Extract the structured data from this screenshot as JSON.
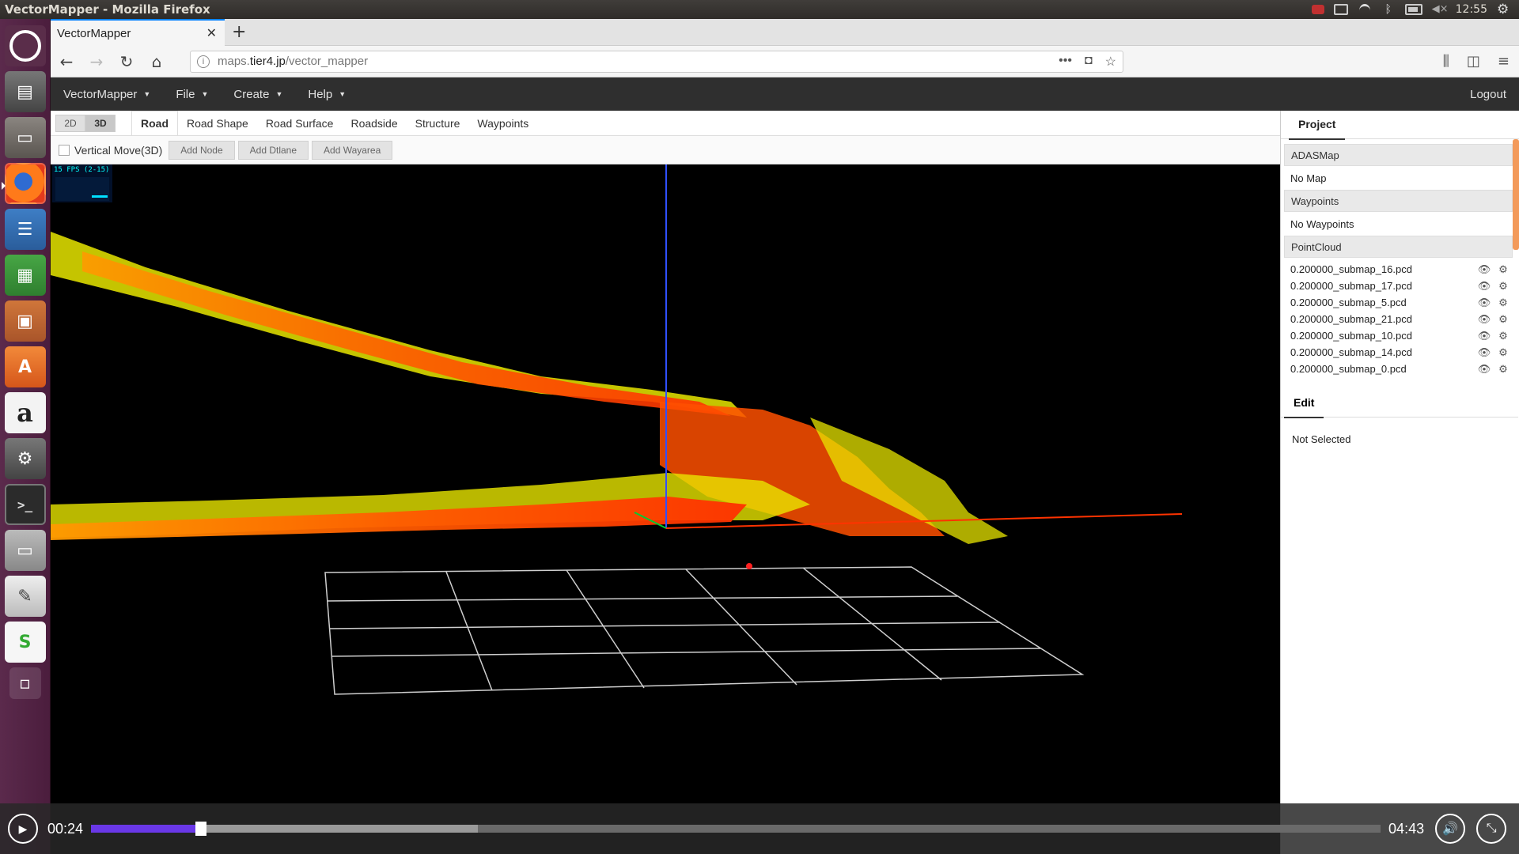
{
  "system": {
    "window_title": "VectorMapper - Mozilla Firefox",
    "clock": "12:55"
  },
  "launcher": {
    "icons": [
      "ubuntu-dash-icon",
      "system-info-icon",
      "files-icon",
      "firefox-icon",
      "libreoffice-writer-icon",
      "libreoffice-calc-icon",
      "libreoffice-impress-icon",
      "software-center-icon",
      "amazon-icon",
      "system-settings-icon",
      "terminal-icon",
      "window-icon",
      "text-editor-icon",
      "slack-icon",
      "trash-icon"
    ]
  },
  "browser": {
    "tab_title": "VectorMapper",
    "url_plain": "maps.",
    "url_host": "tier4.jp",
    "url_path": "/vector_mapper"
  },
  "appbar": {
    "menus": [
      {
        "label": "VectorMapper"
      },
      {
        "label": "File"
      },
      {
        "label": "Create"
      },
      {
        "label": "Help"
      }
    ],
    "logout": "Logout"
  },
  "toolbar": {
    "dim_2d": "2D",
    "dim_3d": "3D",
    "tabs": [
      "Road",
      "Road Shape",
      "Road Surface",
      "Roadside",
      "Structure",
      "Waypoints"
    ],
    "vertical_move": "Vertical Move(3D)",
    "add_node": "Add Node",
    "add_dtlane": "Add Dtlane",
    "add_wayarea": "Add Wayarea"
  },
  "viewport": {
    "fps_label": "15 FPS (2-15)"
  },
  "project": {
    "tab_label": "Project",
    "adasmap_header": "ADASMap",
    "adasmap_value": "No Map",
    "waypoints_header": "Waypoints",
    "waypoints_value": "No Waypoints",
    "pointcloud_header": "PointCloud",
    "pointclouds": [
      "0.200000_submap_16.pcd",
      "0.200000_submap_17.pcd",
      "0.200000_submap_5.pcd",
      "0.200000_submap_21.pcd",
      "0.200000_submap_10.pcd",
      "0.200000_submap_14.pcd",
      "0.200000_submap_0.pcd"
    ]
  },
  "edit": {
    "tab_label": "Edit",
    "status": "Not Selected"
  },
  "player": {
    "current_time": "00:24",
    "total_time": "04:43",
    "progress_fraction": 0.085,
    "buffered_fraction": 0.3
  }
}
